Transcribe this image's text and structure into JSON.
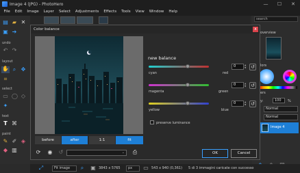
{
  "app": {
    "title": "Image 4 (JPG) - PhotoHero"
  },
  "window_controls": {
    "minimize": "—",
    "maximize": "☐",
    "close": "✕"
  },
  "menu": [
    "File",
    "Edit",
    "Image",
    "Layer",
    "Select",
    "Adjustments",
    "Effects",
    "Tools",
    "View",
    "Window",
    "Help"
  ],
  "left_panel": {
    "undo": "undo",
    "layout": "layout",
    "select": "select",
    "text": "text",
    "paint": "paint"
  },
  "right_panel": {
    "search_placeholder": "search",
    "overview": "overview",
    "colors": "lors",
    "layers": "ers",
    "opacity_label": "y:",
    "opacity_value": "100",
    "opacity_unit": "%",
    "blend_mode_1": "Normal",
    "blend_mode_2": "Normal",
    "layer_name": "Image 4"
  },
  "dialog": {
    "title": "Color balance",
    "close": "x",
    "heading": "new balance",
    "sliders": [
      {
        "left": "cyan",
        "right": "red",
        "value": "0"
      },
      {
        "left": "magenta",
        "right": "green",
        "value": "0"
      },
      {
        "left": "yellow",
        "right": "blue",
        "value": "0"
      }
    ],
    "preserve_luminance": "preserve luminance",
    "view_tabs": [
      "before",
      "after",
      "1:1",
      "fit"
    ],
    "ok": "OK",
    "cancel": "Cancel"
  },
  "statusbar": {
    "zoom_fit": "Fit image",
    "dimensions": "3843 x 5765",
    "unit": "px",
    "selection": "543 x 940 (0,361)",
    "message": "5 di 3 immagini caricate con successo"
  },
  "colors": {
    "accent": "#3aa0ff",
    "active_tab": "#1e7fd6",
    "close": "#d9434b"
  }
}
